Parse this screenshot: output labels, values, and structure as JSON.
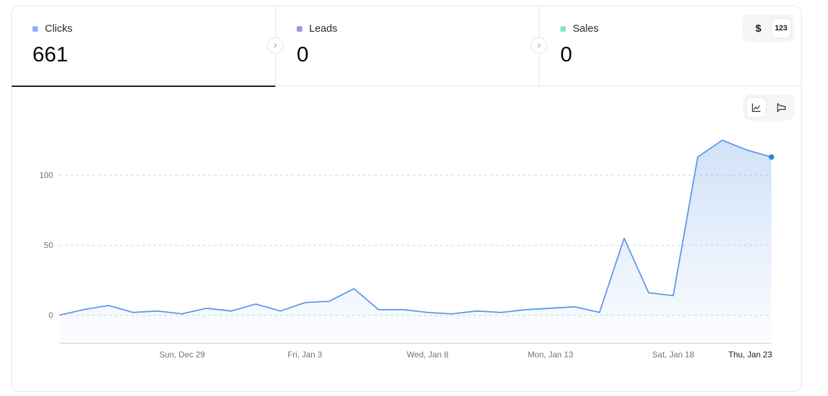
{
  "metrics": [
    {
      "label": "Clicks",
      "value": "661",
      "color": "#8fb0f0",
      "active": true
    },
    {
      "label": "Leads",
      "value": "0",
      "color": "#b18ce6",
      "active": false
    },
    {
      "label": "Sales",
      "value": "0",
      "color": "#8fe0d8",
      "active": false
    }
  ],
  "unit_toggle": {
    "currency": "$",
    "count": "123",
    "selected": "count"
  },
  "chart_toggle": {
    "options": [
      "line-chart-icon",
      "funnel-chart-icon"
    ],
    "selected": "line-chart-icon"
  },
  "chart_data": {
    "type": "area",
    "series": [
      {
        "color": "#5b96e8",
        "values": [
          0,
          4,
          7,
          2,
          3,
          1,
          5,
          3,
          8,
          3,
          9,
          10,
          19,
          4,
          4,
          2,
          1,
          3,
          2,
          4,
          5,
          6,
          2,
          55,
          16,
          14,
          113,
          125,
          118,
          113
        ]
      }
    ],
    "x_labels": [
      "Sun, Dec 29",
      "Fri, Jan 3",
      "Wed, Jan 8",
      "Mon, Jan 13",
      "Sat, Jan 18",
      "Thu, Jan 23"
    ],
    "x_label_indices": [
      5,
      10,
      15,
      20,
      25,
      29
    ],
    "y_ticks": [
      0,
      50,
      100
    ],
    "ylim": [
      -20,
      150
    ],
    "grid": true,
    "title": "",
    "xlabel": "",
    "ylabel": ""
  }
}
